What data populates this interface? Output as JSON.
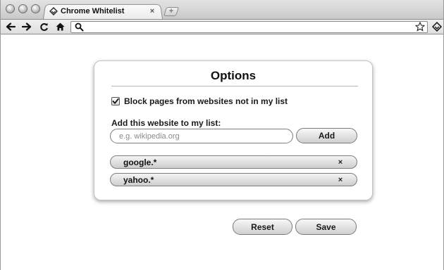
{
  "browser": {
    "tab": {
      "title": "Chrome Whitelist",
      "favicon": "diamond-shield-icon",
      "close_glyph": "×"
    },
    "new_tab_glyph": "+",
    "toolbar": {
      "back_icon": "back-arrow-icon",
      "forward_icon": "forward-arrow-icon",
      "reload_icon": "reload-icon",
      "home_icon": "home-icon",
      "search_icon": "search-icon",
      "url_value": "",
      "bookmark_icon": "star-icon",
      "extension_icon": "extension-icon"
    }
  },
  "options": {
    "title": "Options",
    "block_checkbox": {
      "label": "Block pages from websites not in my list",
      "checked": true
    },
    "add_site": {
      "label": "Add this website to my list:",
      "placeholder": "e.g. wikipedia.org",
      "value": "",
      "button_label": "Add"
    },
    "sites": [
      {
        "pattern": "google.*",
        "remove_glyph": "×"
      },
      {
        "pattern": "yahoo.*",
        "remove_glyph": "×"
      }
    ]
  },
  "actions": {
    "reset_label": "Reset",
    "save_label": "Save"
  }
}
